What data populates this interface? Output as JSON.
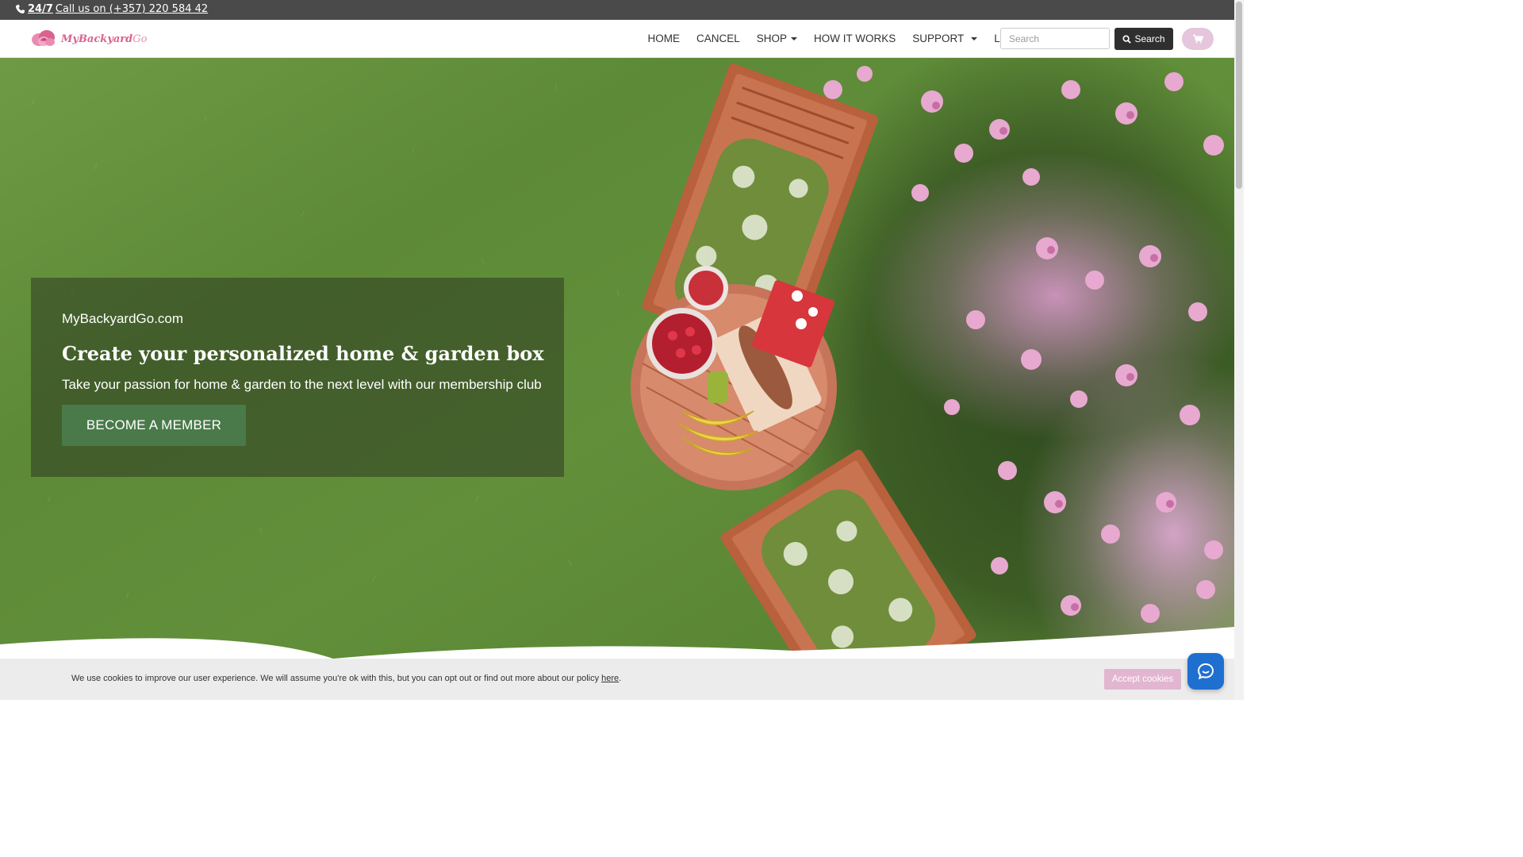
{
  "topbar": {
    "phone_bold": "24/7",
    "phone_text": " Call us on (+357) 220 584 42",
    "icon": "phone-icon"
  },
  "navbar": {
    "logo": {
      "brand": "MyBackyard",
      "suffix": "Go",
      "icon": "flower-logo-icon"
    },
    "items": [
      {
        "label": "HOME",
        "dropdown": false
      },
      {
        "label": "CANCEL",
        "dropdown": false
      },
      {
        "label": "SHOP",
        "dropdown": true
      },
      {
        "label": "HOW IT WORKS",
        "dropdown": false
      },
      {
        "label": "SUPPORT",
        "dropdown": true
      },
      {
        "label": "LOGIN",
        "dropdown": false
      }
    ],
    "search": {
      "placeholder": "Search",
      "value": "",
      "button_label": "Search",
      "icon": "search-icon"
    },
    "cart": {
      "icon": "cart-icon",
      "color": "#e6c6dc"
    }
  },
  "hero": {
    "site_name": "MyBackyardGo.com",
    "title": "Create your personalized home & garden box",
    "subtitle": "Take your passion for home & garden to the next level with our membership club",
    "cta_label": "BECOME A MEMBER"
  },
  "cookie_bar": {
    "text": "We use cookies to improve our user experience. We will assume you're ok with this, but you can opt out or find out more about our policy ",
    "link_text": "here",
    "suffix": ".",
    "accept_label": "Accept cookies"
  },
  "chat": {
    "icon": "chat-bubble-icon",
    "color": "#1f6fd1"
  },
  "colors": {
    "accent_pink": "#e6c6dc",
    "cta_green": "#4a7a4a",
    "topbar": "#4a4a4a",
    "search_button": "#2f2f2f"
  }
}
